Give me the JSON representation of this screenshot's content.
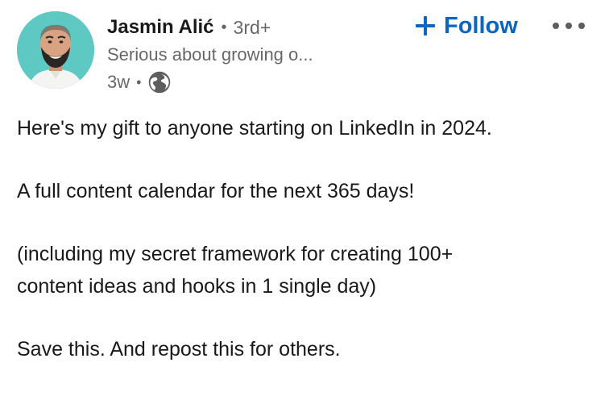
{
  "author": {
    "name": "Jasmin Alić",
    "degree": "3rd+",
    "headline": "Serious about growing o...",
    "time_ago": "3w",
    "visibility_icon": "globe-icon",
    "avatar_bg": "#5ec9c2"
  },
  "actions": {
    "follow_label": "Follow",
    "follow_icon": "plus-icon",
    "more_icon": "more-horizontal-icon"
  },
  "post": {
    "line1": "Here's my gift to anyone starting on LinkedIn in 2024.",
    "line2": "A full content calendar for the next 365 days!",
    "line3a": "(including my secret framework for creating 100+",
    "line3b": "content ideas and hooks in 1 single day)",
    "line4": "Save this. And repost this for others."
  },
  "colors": {
    "accent": "#0a66c2",
    "text_primary": "rgba(0,0,0,0.9)",
    "text_secondary": "rgba(0,0,0,0.6)"
  }
}
